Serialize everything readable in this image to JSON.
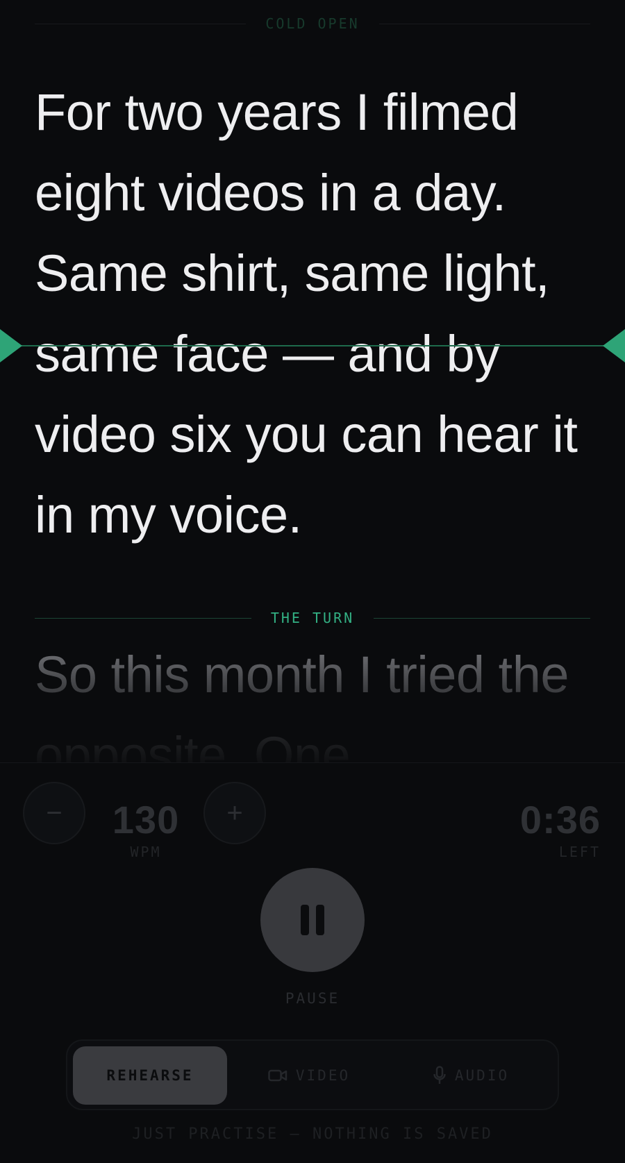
{
  "script": {
    "sections": [
      {
        "label": "COLD OPEN",
        "state": "past"
      },
      {
        "label": "THE TURN",
        "state": "current"
      }
    ],
    "current_paragraph": "For two years I filmed eight videos in a day. Same shirt, same light, same face — and by video six you can hear it in my voice.",
    "next_paragraph": "So this month I tried the opposite. One"
  },
  "speed": {
    "decrease_label": "−",
    "increase_label": "+",
    "value": "130",
    "unit": "WPM"
  },
  "timer": {
    "value": "0:36",
    "label": "LEFT"
  },
  "playback": {
    "state": "paused-icon",
    "label": "PAUSE"
  },
  "modes": [
    {
      "label": "REHEARSE",
      "icon": "",
      "active": true
    },
    {
      "label": "VIDEO",
      "icon": "video-camera-icon",
      "active": false
    },
    {
      "label": "AUDIO",
      "icon": "microphone-icon",
      "active": false
    }
  ],
  "footnote": "JUST PRACTISE — NOTHING IS SAVED",
  "colors": {
    "accent": "#2ea477",
    "background": "#0a0b0d",
    "text": "#eeeef0"
  }
}
